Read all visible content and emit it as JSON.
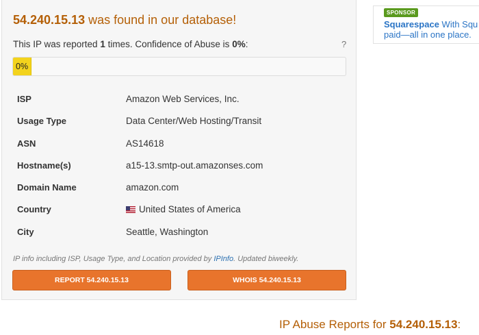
{
  "header": {
    "ip": "54.240.15.13",
    "title_suffix": " was found in our database!"
  },
  "report_summary": {
    "prefix": "This IP was reported ",
    "count": "1",
    "middle": " times. Confidence of Abuse is ",
    "confidence": "0%",
    "suffix": ":",
    "help": "?"
  },
  "confidence_bar": {
    "label": "0%",
    "value_percent": 0,
    "color": "#f3d31d"
  },
  "details": [
    {
      "key": "ISP",
      "value": "Amazon Web Services, Inc."
    },
    {
      "key": "Usage Type",
      "value": "Data Center/Web Hosting/Transit"
    },
    {
      "key": "ASN",
      "value": "AS14618"
    },
    {
      "key": "Hostname(s)",
      "value": "a15-13.smtp-out.amazonses.com"
    },
    {
      "key": "Domain Name",
      "value": "amazon.com"
    },
    {
      "key": "Country",
      "value": "United States of America",
      "icon": "us-flag-icon"
    },
    {
      "key": "City",
      "value": "Seattle, Washington"
    }
  ],
  "credit": {
    "prefix": "IP info including ISP, Usage Type, and Location provided by ",
    "link": "IPInfo",
    "suffix": ". Updated biweekly."
  },
  "buttons": {
    "report": "REPORT 54.240.15.13",
    "whois": "WHOIS 54.240.15.13",
    "color": "#e8742c"
  },
  "sponsor": {
    "tag": "SPONSOR",
    "brand": "Squarespace",
    "line1": "  With Squ",
    "line2": "paid—all in one place."
  },
  "reports_heading": {
    "prefix": "IP Abuse Reports for ",
    "ip": "54.240.15.13",
    "suffix": ":"
  },
  "colors": {
    "title": "#b45f06",
    "link": "#2a6fb0",
    "sponsor_tag": "#5a9a1e"
  }
}
